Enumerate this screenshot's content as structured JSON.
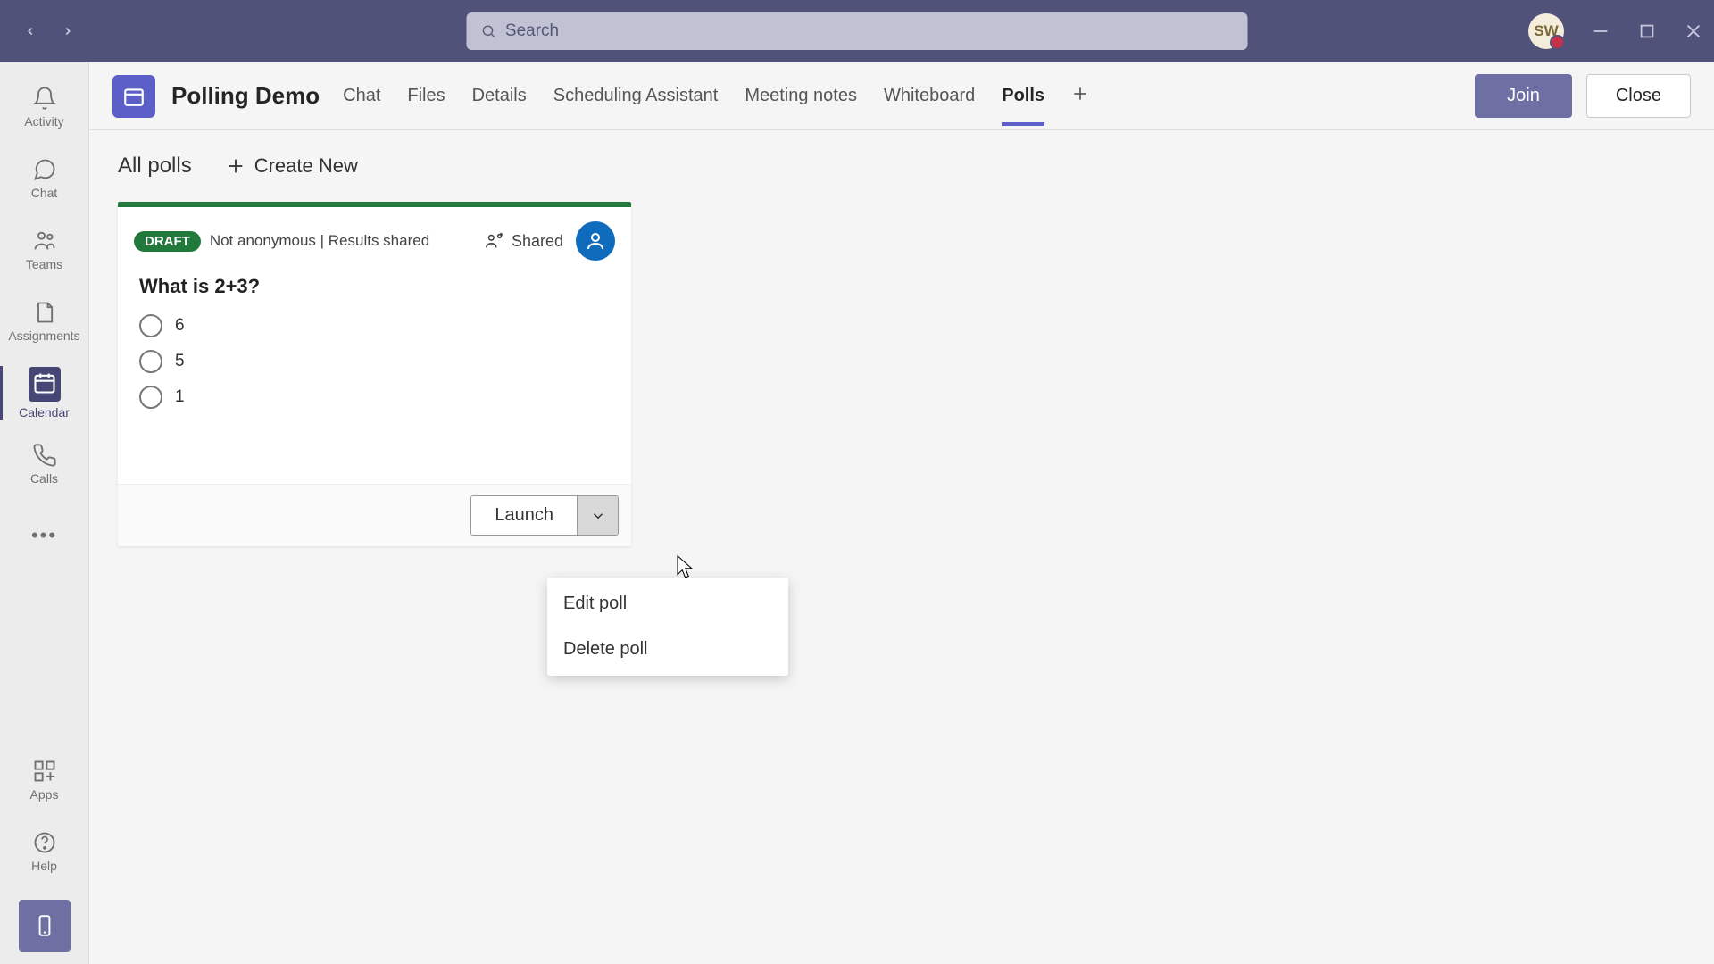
{
  "search": {
    "placeholder": "Search"
  },
  "avatar_initials": "SW",
  "rail": {
    "items": [
      {
        "label": "Activity"
      },
      {
        "label": "Chat"
      },
      {
        "label": "Teams"
      },
      {
        "label": "Assignments"
      },
      {
        "label": "Calendar"
      },
      {
        "label": "Calls"
      }
    ],
    "apps_label": "Apps",
    "help_label": "Help"
  },
  "header": {
    "title": "Polling Demo",
    "tabs": [
      "Chat",
      "Files",
      "Details",
      "Scheduling Assistant",
      "Meeting notes",
      "Whiteboard",
      "Polls"
    ],
    "active_tab_index": 6,
    "join_label": "Join",
    "close_label": "Close"
  },
  "polls": {
    "list_title": "All polls",
    "create_label": "Create New",
    "card": {
      "badge": "DRAFT",
      "meta": "Not anonymous | Results shared",
      "shared_label": "Shared",
      "question": "What is 2+3?",
      "options": [
        "6",
        "5",
        "1"
      ],
      "launch_label": "Launch"
    },
    "menu": {
      "edit": "Edit poll",
      "delete": "Delete poll"
    }
  }
}
